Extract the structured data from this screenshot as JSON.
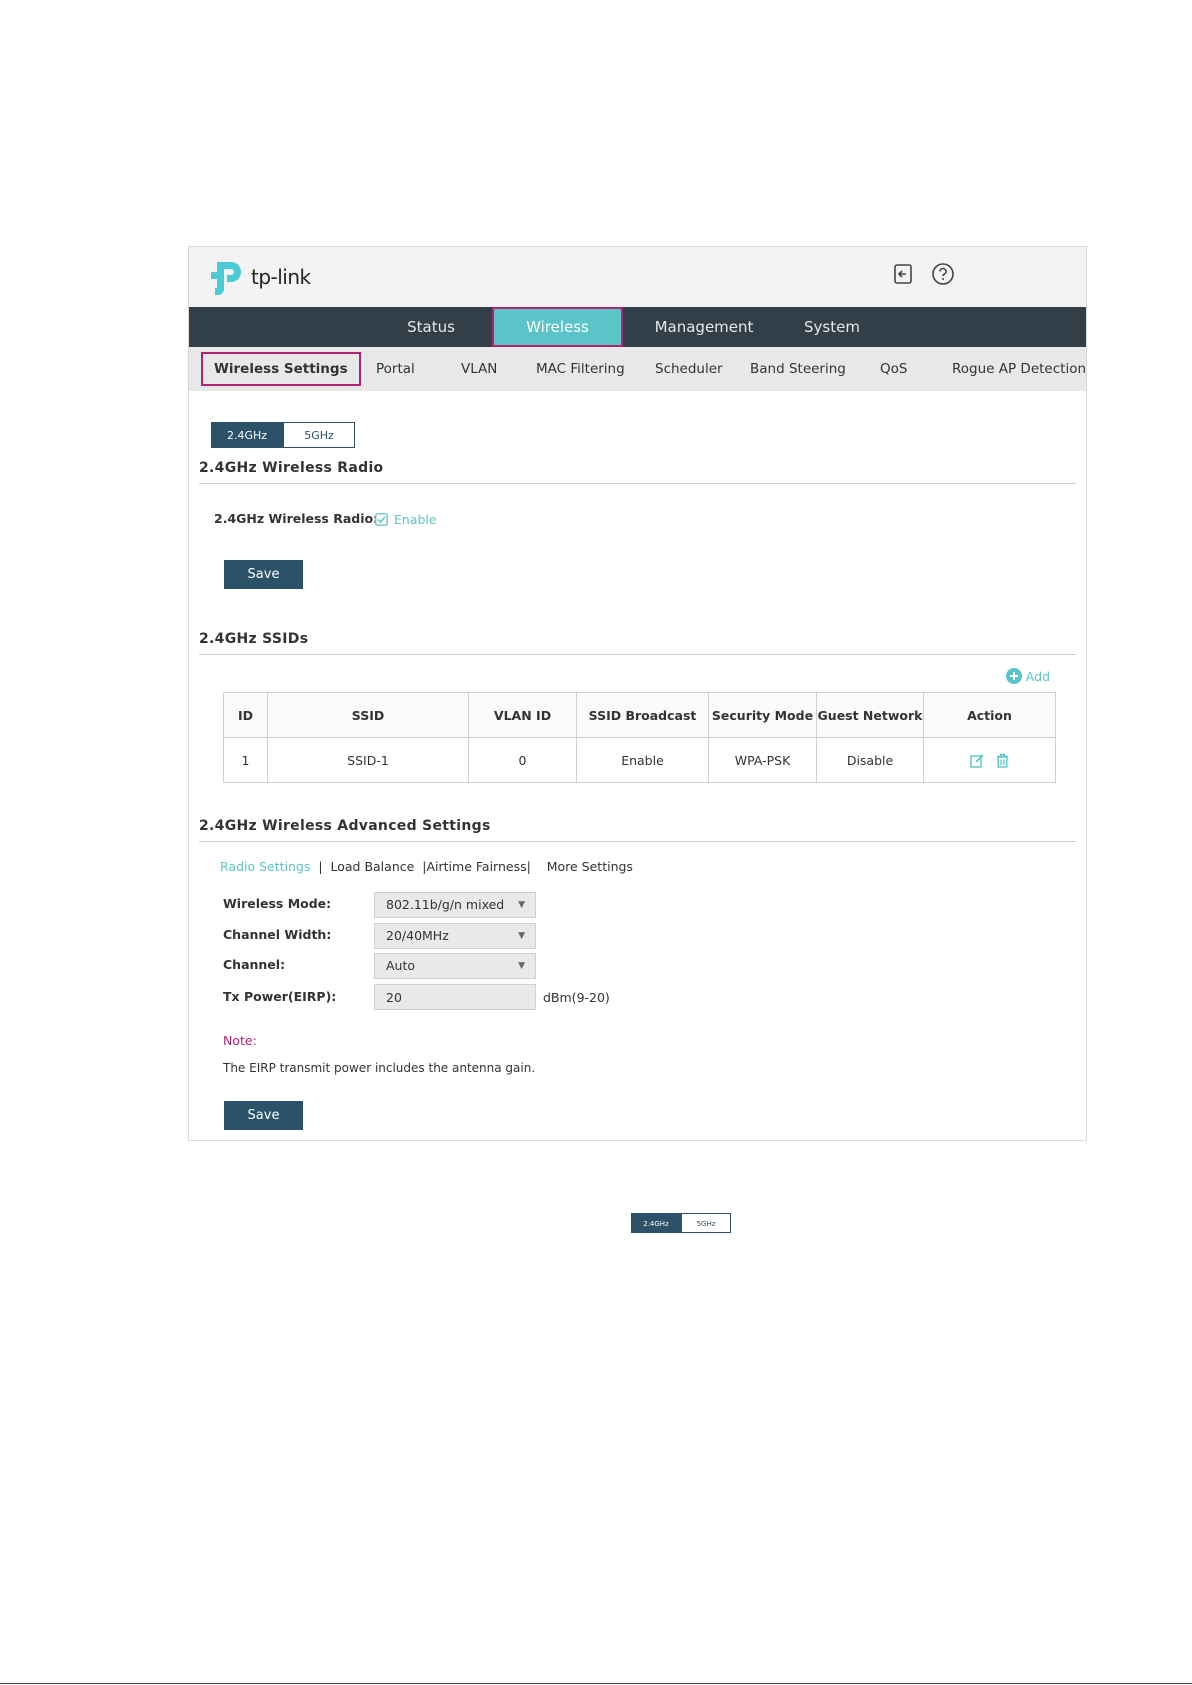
{
  "brand": {
    "name": "tp-link",
    "color": "#4acbd6"
  },
  "top_icons": [
    "logout-icon",
    "help-icon"
  ],
  "main_nav": {
    "items": [
      {
        "label": "Status"
      },
      {
        "label": "Wireless",
        "active": true
      },
      {
        "label": "Management"
      },
      {
        "label": "System"
      }
    ]
  },
  "sub_nav": {
    "items": [
      {
        "label": "Wireless Settings",
        "active": true
      },
      {
        "label": "Portal"
      },
      {
        "label": "VLAN"
      },
      {
        "label": "MAC Filtering"
      },
      {
        "label": "Scheduler"
      },
      {
        "label": "Band Steering"
      },
      {
        "label": "QoS"
      },
      {
        "label": "Rogue AP Detection"
      }
    ]
  },
  "band": {
    "selected": "2.4GHz",
    "other": "5GHz"
  },
  "radio_section": {
    "title": "2.4GHz Wireless Radio",
    "field_label": "2.4GHz Wireless Radio:",
    "checkbox_label": "Enable",
    "checked": true,
    "save_label": "Save"
  },
  "ssid_section": {
    "title": "2.4GHz SSIDs",
    "add_label": "Add",
    "columns": [
      "ID",
      "SSID",
      "VLAN ID",
      "SSID Broadcast",
      "Security Mode",
      "Guest Network",
      "Action"
    ],
    "rows": [
      {
        "id": "1",
        "ssid": "SSID-1",
        "vlan_id": "0",
        "broadcast": "Enable",
        "security": "WPA-PSK",
        "guest": "Disable"
      }
    ]
  },
  "advanced": {
    "title": "2.4GHz Wireless Advanced Settings",
    "tabs": [
      "Radio Settings",
      "Load Balance",
      "Airtime Fairness",
      "More Settings"
    ],
    "wireless_mode_label": "Wireless Mode:",
    "wireless_mode_value": "802.11b/g/n mixed",
    "channel_width_label": "Channel Width:",
    "channel_width_value": "20/40MHz",
    "channel_label": "Channel:",
    "channel_value": "Auto",
    "tx_power_label": "Tx Power(EIRP):",
    "tx_power_value": "20",
    "tx_power_unit": "dBm(9-20)",
    "note_label": "Note:",
    "note_text": "The EIRP transmit power includes the antenna gain.",
    "save_label": "Save"
  },
  "mini_band": {
    "selected": "2.4GHz",
    "other": "5GHz"
  },
  "colors": {
    "accent": "#5bc4c8",
    "dark": "#2b5268",
    "nav": "#333f48",
    "highlight": "#b2226e",
    "note": "#b2226e"
  }
}
